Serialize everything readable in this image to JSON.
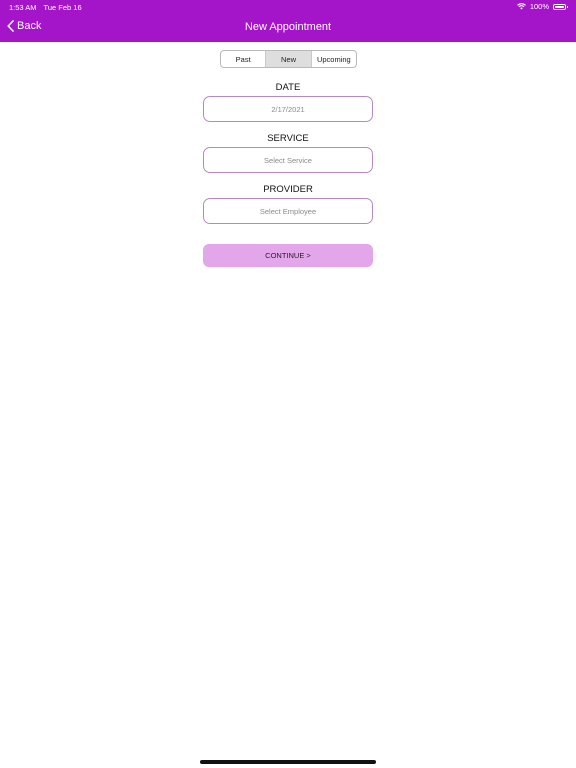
{
  "status_bar": {
    "time": "1:53 AM",
    "date": "Tue Feb 16",
    "battery": "100%"
  },
  "nav": {
    "back_label": "Back",
    "title": "New Appointment"
  },
  "tabs": [
    {
      "label": "Past"
    },
    {
      "label": "New"
    },
    {
      "label": "Upcoming"
    }
  ],
  "active_tab": "New",
  "form": {
    "date": {
      "label": "DATE",
      "value": "2/17/2021"
    },
    "service": {
      "label": "SERVICE",
      "placeholder": "Select Service"
    },
    "provider": {
      "label": "PROVIDER",
      "placeholder": "Select Employee"
    }
  },
  "continue_label": "CONTINUE >",
  "colors": {
    "brand": "#a414c8",
    "button": "#e3a6ea",
    "field_border": "#b48bc0"
  }
}
